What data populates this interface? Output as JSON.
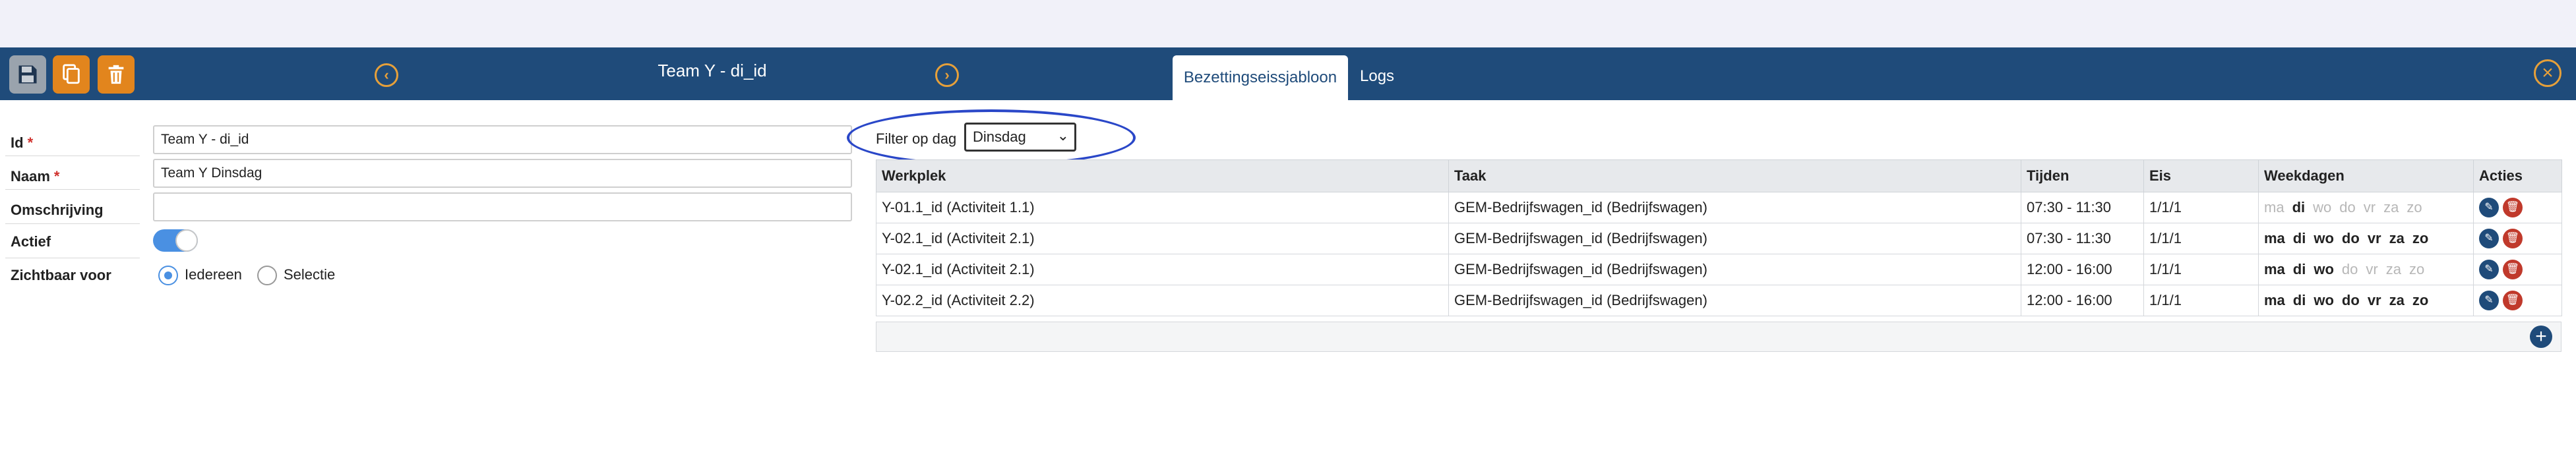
{
  "header": {
    "title": "Team Y - di_id",
    "tabs": [
      "Bezettingseissjabloon",
      "Logs"
    ],
    "icons": {
      "save": "floppy-icon",
      "copy": "copy-icon",
      "delete": "trash-icon",
      "prev": "chevron-left-icon",
      "next": "chevron-right-icon",
      "close": "close-icon"
    },
    "colors": {
      "bar": "#1f4b7a",
      "accent": "#e2851d"
    }
  },
  "form": {
    "id": {
      "label": "Id",
      "value": "Team Y - di_id"
    },
    "naam": {
      "label": "Naam",
      "value": "Team Y Dinsdag"
    },
    "omschrijving": {
      "label": "Omschrijving",
      "value": ""
    },
    "actief": {
      "label": "Actief",
      "on": true
    },
    "zichtbaar": {
      "label": "Zichtbaar voor",
      "options": [
        "Iedereen",
        "Selectie"
      ],
      "selected": "Iedereen"
    },
    "required_mark": "*"
  },
  "filter": {
    "label": "Filter op dag",
    "value": "Dinsdag"
  },
  "table": {
    "columns": [
      "Werkplek",
      "Taak",
      "Tijden",
      "Eis",
      "Weekdagen",
      "Acties"
    ],
    "rows": [
      {
        "werkplek": "Y-01.1_id (Activiteit 1.1)",
        "taak": "GEM-Bedrijfswagen_id (Bedrijfswagen)",
        "tijden": "07:30 - 11:30",
        "eis": "1/1/1",
        "days": [
          {
            "d": "ma",
            "on": false
          },
          {
            "d": "di",
            "on": true
          },
          {
            "d": "wo",
            "on": false
          },
          {
            "d": "do",
            "on": false
          },
          {
            "d": "vr",
            "on": false
          },
          {
            "d": "za",
            "on": false
          },
          {
            "d": "zo",
            "on": false
          }
        ]
      },
      {
        "werkplek": "Y-02.1_id (Activiteit 2.1)",
        "taak": "GEM-Bedrijfswagen_id (Bedrijfswagen)",
        "tijden": "07:30 - 11:30",
        "eis": "1/1/1",
        "days": [
          {
            "d": "ma",
            "on": true
          },
          {
            "d": "di",
            "on": true
          },
          {
            "d": "wo",
            "on": true
          },
          {
            "d": "do",
            "on": true
          },
          {
            "d": "vr",
            "on": true
          },
          {
            "d": "za",
            "on": true
          },
          {
            "d": "zo",
            "on": true
          }
        ]
      },
      {
        "werkplek": "Y-02.1_id (Activiteit 2.1)",
        "taak": "GEM-Bedrijfswagen_id (Bedrijfswagen)",
        "tijden": "12:00 - 16:00",
        "eis": "1/1/1",
        "days": [
          {
            "d": "ma",
            "on": true
          },
          {
            "d": "di",
            "on": true
          },
          {
            "d": "wo",
            "on": true
          },
          {
            "d": "do",
            "on": false
          },
          {
            "d": "vr",
            "on": false
          },
          {
            "d": "za",
            "on": false
          },
          {
            "d": "zo",
            "on": false
          }
        ]
      },
      {
        "werkplek": "Y-02.2_id (Activiteit 2.2)",
        "taak": "GEM-Bedrijfswagen_id (Bedrijfswagen)",
        "tijden": "12:00 - 16:00",
        "eis": "1/1/1",
        "days": [
          {
            "d": "ma",
            "on": true
          },
          {
            "d": "di",
            "on": true
          },
          {
            "d": "wo",
            "on": true
          },
          {
            "d": "do",
            "on": true
          },
          {
            "d": "vr",
            "on": true
          },
          {
            "d": "za",
            "on": true
          },
          {
            "d": "zo",
            "on": true
          }
        ]
      }
    ]
  }
}
